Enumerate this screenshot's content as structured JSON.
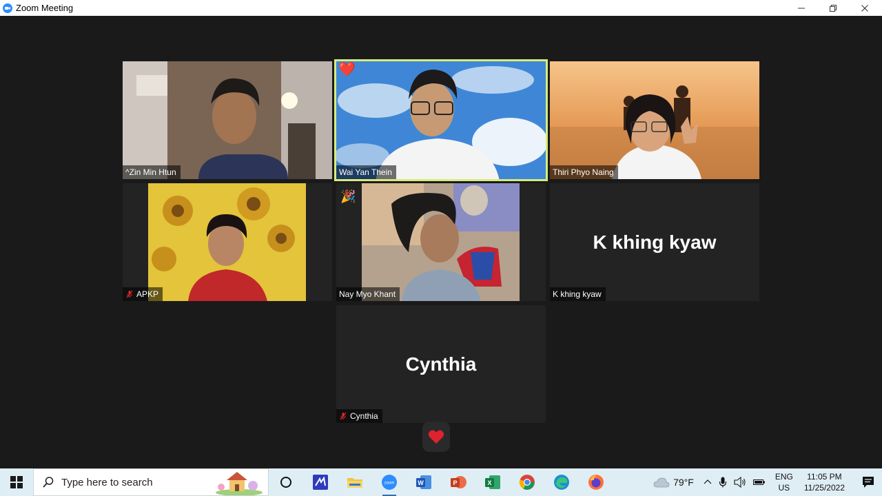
{
  "window": {
    "title": "Zoom Meeting",
    "app_icon": "zoom-icon",
    "controls": [
      "minimize-icon",
      "restore-icon",
      "close-icon"
    ]
  },
  "tiles": [
    {
      "id": "zin-min-htun",
      "name": "^Zin Min Htun",
      "video": true,
      "muted": false,
      "reaction": ""
    },
    {
      "id": "wai-yan-thein",
      "name": "Wai Yan Thein",
      "video": true,
      "muted": false,
      "reaction": "❤️",
      "active_speaker": true
    },
    {
      "id": "thiri-phyo-naing",
      "name": "Thiri Phyo Naing",
      "video": true,
      "muted": false,
      "reaction": ""
    },
    {
      "id": "apkp",
      "name": "APKP",
      "video": true,
      "muted": true,
      "reaction": ""
    },
    {
      "id": "nay-myo-khant",
      "name": "Nay Myo Khant",
      "video": true,
      "muted": false,
      "reaction": "🎉"
    },
    {
      "id": "k-khing-kyaw",
      "name": "K khing kyaw",
      "video": false,
      "muted": false,
      "reaction": ""
    },
    {
      "id": "cynthia",
      "name": "Cynthia",
      "video": false,
      "muted": true,
      "reaction": ""
    }
  ],
  "reaction_button": {
    "icon": "heart-icon"
  },
  "taskbar": {
    "search_placeholder": "Type here to search",
    "pinned": [
      "task-view-icon",
      "vscode-icon",
      "file-explorer-icon",
      "zoom-icon",
      "word-icon",
      "powerpoint-icon",
      "excel-icon",
      "chrome-icon",
      "edge-icon",
      "firefox-icon"
    ],
    "weather": "79°F",
    "lang_top": "ENG",
    "lang_bottom": "US",
    "time": "11:05 PM",
    "date": "11/25/2022"
  },
  "colors": {
    "stage_bg": "#1a1a1a",
    "active_border": "#d6ec7c",
    "zoom_blue": "#2d8cff",
    "mic_off_red": "#e02828"
  }
}
